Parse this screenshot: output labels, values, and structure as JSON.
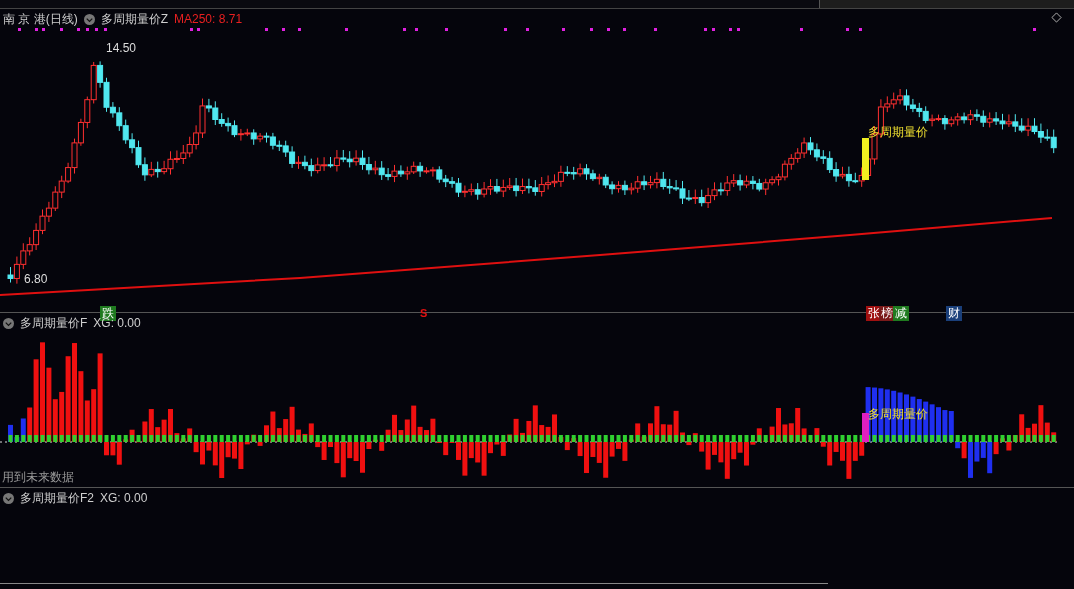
{
  "main_panel": {
    "stock": "南 京 港(日线)",
    "indicator": "多周期量价Z",
    "ma_reading": "MA250: 8.71",
    "high_label": "14.50",
    "low_label": "6.80",
    "signal_label": "多周期量价",
    "tags": [
      {
        "text": "跌",
        "kind": "box",
        "color": "#1f7a1f"
      },
      {
        "text": "S",
        "kind": "plain",
        "color": "#e01010"
      },
      {
        "text": "张",
        "kind": "box",
        "color": "#a01010"
      },
      {
        "text": "榜",
        "kind": "box",
        "color": "#7a1a1a"
      },
      {
        "text": "减",
        "kind": "box",
        "color": "#1f7a1f"
      },
      {
        "text": "财",
        "kind": "box",
        "color": "#1a3f7a"
      }
    ]
  },
  "volume_panel": {
    "indicator": "多周期量价F",
    "reading": "XG: 0.00",
    "signal_label": "多周期量价",
    "note": "用到未来数据"
  },
  "panel_3": {
    "indicator": "多周期量价F2",
    "reading": "XG: 0.00"
  }
}
